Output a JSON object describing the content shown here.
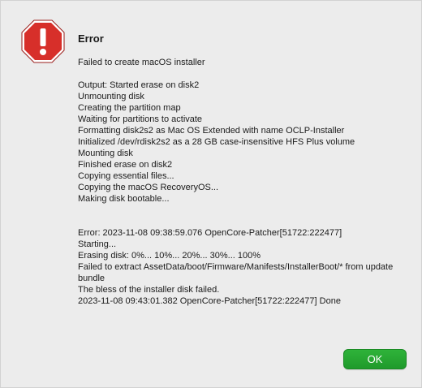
{
  "dialog": {
    "title": "Error",
    "icon": "stop-octagon-exclamation-icon",
    "message": {
      "headline": "Failed to create macOS installer",
      "output_lines": [
        "Output: Started erase on disk2",
        "Unmounting disk",
        "Creating the partition map",
        "Waiting for partitions to activate",
        "Formatting disk2s2 as Mac OS Extended with name OCLP-Installer",
        "Initialized /dev/rdisk2s2 as a 28 GB case-insensitive HFS Plus volume",
        "Mounting disk",
        "Finished erase on disk2",
        "Copying essential files...",
        "Copying the macOS RecoveryOS...",
        "Making disk bootable..."
      ],
      "error_lines": [
        "Error: 2023-11-08 09:38:59.076 OpenCore-Patcher[51722:222477]",
        "Starting...",
        "Erasing disk: 0%... 10%... 20%... 30%... 100%",
        "Failed to extract AssetData/boot/Firmware/Manifests/InstallerBoot/* from update bundle",
        "The bless of the installer disk failed.",
        "2023-11-08 09:43:01.382 OpenCore-Patcher[51722:222477] Done"
      ]
    },
    "ok_label": "OK"
  },
  "colors": {
    "background": "#ececec",
    "icon_red": "#d72f2a",
    "ok_green": "#27a532",
    "text": "#1a1a1a"
  }
}
